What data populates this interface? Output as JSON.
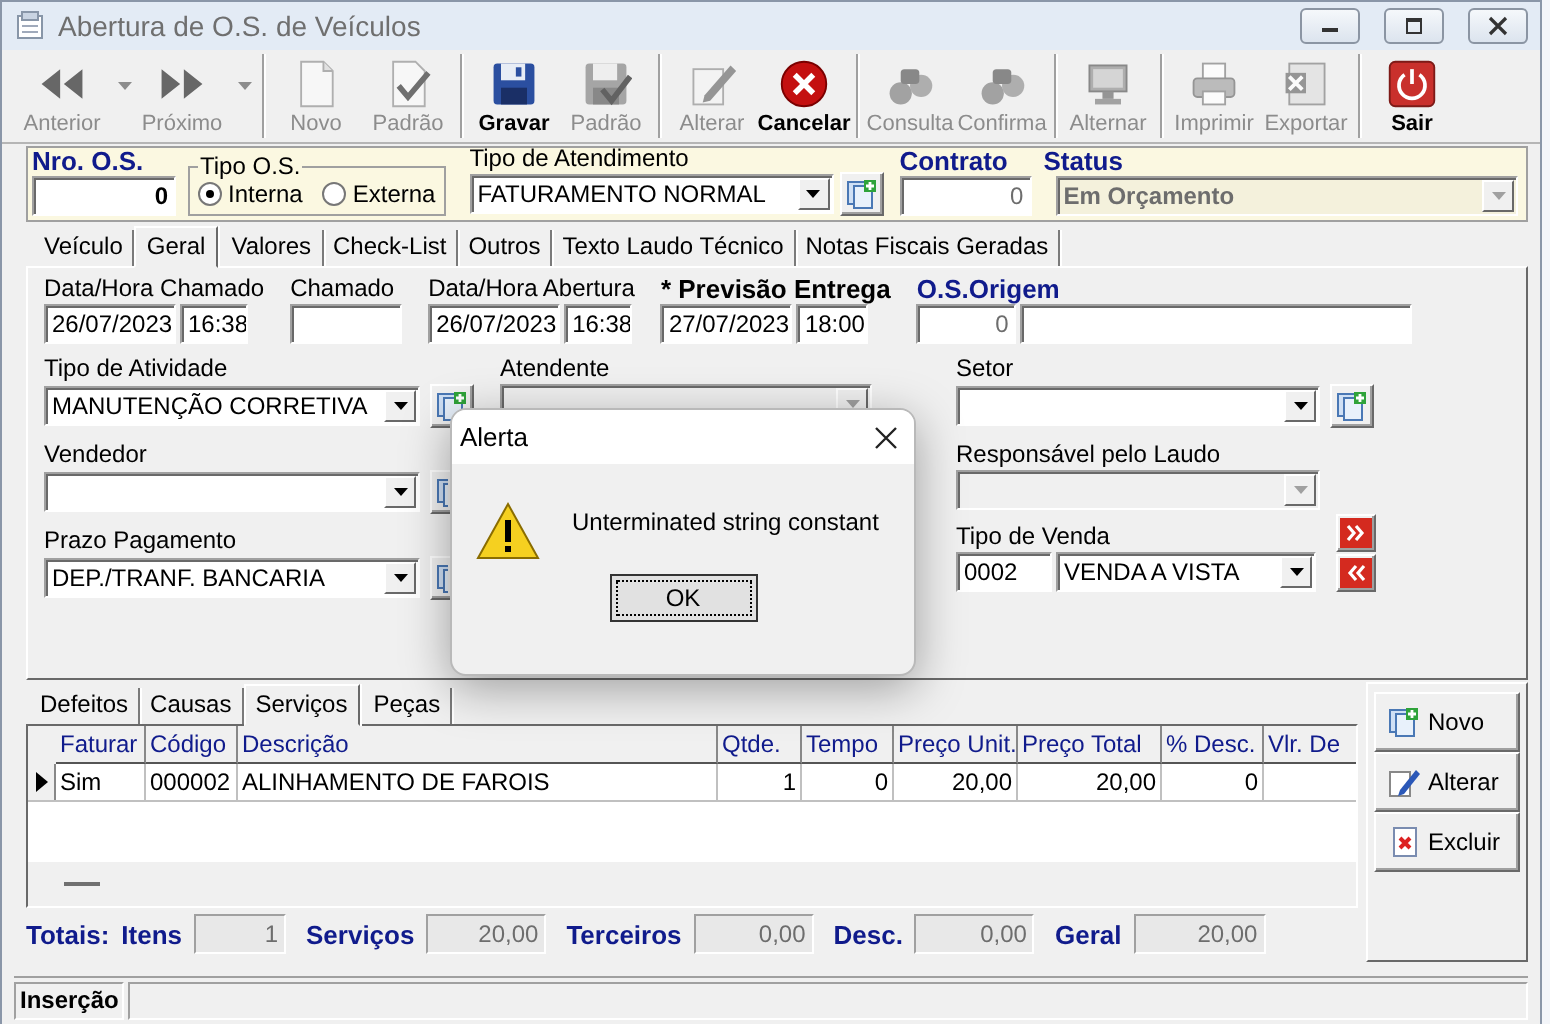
{
  "window": {
    "title": "Abertura de O.S. de Veículos"
  },
  "toolbar": [
    {
      "buttons": [
        {
          "label": "Anterior",
          "disabled": true,
          "dropdown": true
        },
        {
          "label": "Próximo",
          "disabled": true,
          "dropdown": true
        }
      ]
    },
    {
      "buttons": [
        {
          "label": "Novo",
          "disabled": true,
          "dropdown": false
        },
        {
          "label": "Padrão",
          "disabled": true,
          "dropdown": false
        }
      ]
    },
    {
      "buttons": [
        {
          "label": "Gravar",
          "disabled": false,
          "dropdown": false
        },
        {
          "label": "Padrão",
          "disabled": true,
          "dropdown": false
        }
      ]
    },
    {
      "buttons": [
        {
          "label": "Alterar",
          "disabled": true,
          "dropdown": false
        },
        {
          "label": "Cancelar",
          "disabled": false,
          "dropdown": false
        }
      ]
    },
    {
      "buttons": [
        {
          "label": "Consulta",
          "disabled": true,
          "dropdown": false
        },
        {
          "label": "Confirma",
          "disabled": true,
          "dropdown": false
        }
      ]
    },
    {
      "buttons": [
        {
          "label": "Alternar",
          "disabled": true,
          "dropdown": false
        }
      ]
    },
    {
      "buttons": [
        {
          "label": "Imprimir",
          "disabled": true,
          "dropdown": false
        },
        {
          "label": "Exportar",
          "disabled": true,
          "dropdown": false
        }
      ]
    },
    {
      "buttons": [
        {
          "label": "Sair",
          "disabled": false,
          "dropdown": false
        }
      ]
    }
  ],
  "header": {
    "os_number": {
      "label": "Nro. O.S.",
      "value": "0"
    },
    "os_type": {
      "label": "Tipo O.S.",
      "options": [
        {
          "label": "Interna",
          "selected": true
        },
        {
          "label": "Externa",
          "selected": false
        }
      ]
    },
    "service_type": {
      "label": "Tipo de Atendimento",
      "value": "FATURAMENTO NORMAL"
    },
    "contract": {
      "label": "Contrato",
      "value": "0"
    },
    "status": {
      "label": "Status",
      "value": "Em Orçamento",
      "disabled": true
    }
  },
  "tabs": [
    {
      "label": "Veículo",
      "selected": false
    },
    {
      "label": "Geral",
      "selected": true
    },
    {
      "label": "Valores",
      "selected": false
    },
    {
      "label": "Check-List",
      "selected": false
    },
    {
      "label": "Outros",
      "selected": false
    },
    {
      "label": "Texto Laudo Técnico",
      "selected": false
    },
    {
      "label": "Notas Fiscais Geradas",
      "selected": false
    }
  ],
  "general": {
    "top_row": [
      {
        "label": "Data/Hora Chamado",
        "kind": "plain",
        "controls": [
          {
            "kind": "text",
            "value": "26/07/2023"
          },
          {
            "kind": "text",
            "value": "16:38"
          }
        ]
      },
      {
        "label": "Chamado",
        "kind": "plain",
        "controls": [
          {
            "kind": "text"
          }
        ]
      },
      {
        "label": "Data/Hora Abertura",
        "kind": "plain",
        "controls": [
          {
            "kind": "text",
            "value": "26/07/2023"
          },
          {
            "kind": "text",
            "value": "16:38"
          }
        ]
      },
      {
        "label": "* Previsão Entrega",
        "kind": "required",
        "controls": [
          {
            "kind": "text",
            "value": "27/07/2023"
          },
          {
            "kind": "text",
            "value": "18:00"
          }
        ]
      },
      {
        "label": "O.S.Origem",
        "kind": "link",
        "controls": [
          {
            "kind": "number",
            "value": "0"
          },
          {
            "kind": "text"
          }
        ]
      }
    ],
    "columns": [
      [
        {
          "label": "Tipo de Atividade",
          "kind": "plain",
          "controls": [
            {
              "kind": "combo",
              "value": "MANUTENÇÃO CORRETIVA",
              "disabled": false
            },
            {
              "kind": "add"
            }
          ]
        },
        {
          "label": "Vendedor",
          "kind": "plain",
          "controls": [
            {
              "kind": "combo",
              "disabled": false
            },
            {
              "kind": "add"
            }
          ]
        },
        {
          "label": "Prazo Pagamento",
          "kind": "plain",
          "controls": [
            {
              "kind": "combo",
              "value": "DEP./TRANF. BANCARIA",
              "disabled": false
            },
            {
              "kind": "add"
            }
          ]
        }
      ],
      [
        {
          "label": "Atendente",
          "kind": "plain",
          "controls": [
            {
              "kind": "combo",
              "disabled": true
            }
          ]
        }
      ],
      [
        {
          "label": "Setor",
          "kind": "plain",
          "controls": [
            {
              "kind": "combo",
              "disabled": false
            },
            {
              "kind": "add"
            }
          ]
        },
        {
          "label": "Responsável pelo Laudo",
          "kind": "plain",
          "controls": [
            {
              "kind": "combo",
              "disabled": true
            }
          ]
        },
        {
          "label": "Tipo de Venda",
          "kind": "plain",
          "controls": [
            {
              "kind": "text",
              "value": "0002"
            },
            {
              "kind": "combo",
              "value": "VENDA A VISTA",
              "disabled": false
            },
            {
              "kind": "nav"
            }
          ]
        }
      ]
    ]
  },
  "services": {
    "tabs": [
      {
        "label": "Defeitos",
        "selected": false
      },
      {
        "label": "Causas",
        "selected": false
      },
      {
        "label": "Serviços",
        "selected": true
      },
      {
        "label": "Peças",
        "selected": false
      }
    ],
    "columns": [
      "Faturar",
      "Código",
      "Descrição",
      "Qtde.",
      "Tempo",
      "Preço Unit.",
      "Preço Total",
      "% Desc.",
      "Vlr. De"
    ],
    "rows": [
      {
        "selected": true,
        "cells": [
          "Sim",
          "000002",
          "ALINHAMENTO DE FAROIS",
          "1",
          "0",
          "20,00",
          "20,00",
          "0"
        ]
      }
    ]
  },
  "totals": {
    "label": "Totais:",
    "items": [
      {
        "label": "Itens",
        "value": "1"
      },
      {
        "label": "Serviços",
        "value": "20,00"
      },
      {
        "label": "Terceiros",
        "value": "0,00"
      },
      {
        "label": "Desc.",
        "value": "0,00"
      },
      {
        "label": "Geral",
        "value": "20,00"
      }
    ]
  },
  "side_buttons": [
    "Novo",
    "Alterar",
    "Excluir"
  ],
  "status_bar": {
    "panels": [
      "Inserção"
    ]
  },
  "dialog": {
    "title": "Alerta",
    "message": "Unterminated string constant",
    "button": "OK"
  }
}
